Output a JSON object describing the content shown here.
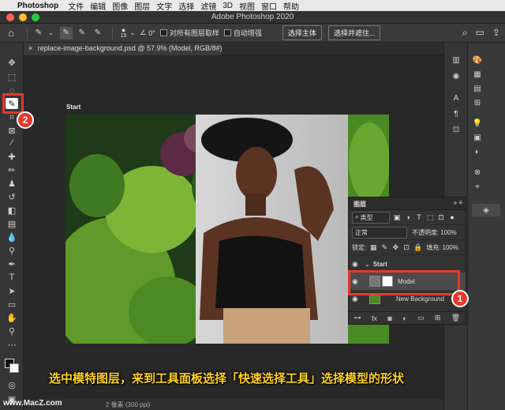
{
  "menubar": {
    "items": [
      "Photoshop",
      "文件",
      "编辑",
      "图像",
      "图层",
      "文字",
      "选择",
      "滤镜",
      "3D",
      "视图",
      "窗口",
      "帮助"
    ]
  },
  "window": {
    "title": "Adobe Photoshop 2020"
  },
  "options": {
    "brush_size": "15",
    "angle": "0°",
    "sample_all_layers": "对所有图层取样",
    "auto_enhance": "自动增强",
    "select_subject": "选择主体",
    "select_and_mask": "选择并遮住..."
  },
  "document": {
    "tab": "replace-image-background.psd @ 57.9% (Model, RGB/8#)",
    "artboard_label": "Start"
  },
  "layers_panel": {
    "title": "图层",
    "filter_kind": "类型",
    "blend_mode": "正常",
    "opacity_label": "不透明度:",
    "opacity_value": "100%",
    "lock_label": "锁定:",
    "fill_label": "填充:",
    "fill_value": "100%",
    "group_name": "Start",
    "layers": [
      {
        "name": "Model"
      },
      {
        "name": "New Background"
      }
    ]
  },
  "callouts": {
    "badge_1": "1",
    "badge_2": "2"
  },
  "caption": "选中模特图层，来到工具面板选择「快速选择工具」选择模型的形状",
  "status": {
    "text": "2 像素 (300 ppi)"
  },
  "watermark": "www.MacZ.com",
  "colors": {
    "callout_red": "#e8382c",
    "caption_yellow": "#ffd21f"
  }
}
